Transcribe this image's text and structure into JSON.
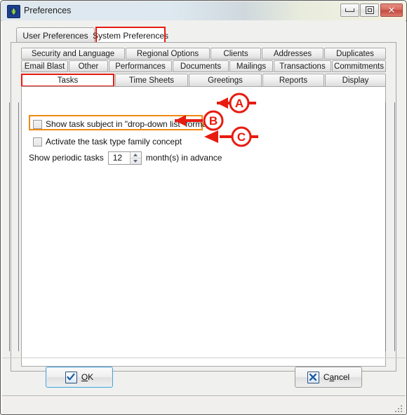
{
  "window": {
    "title": "Preferences",
    "icon": "app-logo-icon",
    "controls": {
      "minimize": "minimize-icon",
      "maximize": "maximize-icon",
      "close": "✕"
    }
  },
  "outer_tabs": {
    "items": [
      {
        "label": "User Preferences",
        "selected": false
      },
      {
        "label": "System Preferences",
        "selected": true,
        "highlight": "red"
      }
    ]
  },
  "inner_tabs": {
    "row1": [
      {
        "label": "Security and Language"
      },
      {
        "label": "Regional Options"
      },
      {
        "label": "Clients"
      },
      {
        "label": "Addresses"
      },
      {
        "label": "Duplicates"
      }
    ],
    "row2": [
      {
        "label": "Email Blast"
      },
      {
        "label": "Other"
      },
      {
        "label": "Performances"
      },
      {
        "label": "Documents"
      },
      {
        "label": "Mailings"
      },
      {
        "label": "Transactions"
      },
      {
        "label": "Commitments"
      }
    ],
    "row3": [
      {
        "label": "Tasks",
        "selected": true,
        "highlight": "red"
      },
      {
        "label": "Time Sheets"
      },
      {
        "label": "Greetings"
      },
      {
        "label": "Reports"
      },
      {
        "label": "Display"
      }
    ]
  },
  "form": {
    "checkbox_show_task_subject": {
      "label": "Show task subject in \"drop-down list\" format",
      "checked": false,
      "highlight": "orange"
    },
    "checkbox_task_type_family": {
      "label": "Activate the task type family concept",
      "checked": false
    },
    "periodic": {
      "prefix": "Show periodic tasks",
      "value": "12",
      "suffix": "month(s) in advance"
    }
  },
  "annotations": [
    {
      "id": "A",
      "label": "A"
    },
    {
      "id": "B",
      "label": "B"
    },
    {
      "id": "C",
      "label": "C"
    }
  ],
  "buttons": {
    "ok": {
      "label": "OK",
      "accel": "O",
      "icon": "check-icon"
    },
    "cancel": {
      "label": "Cancel",
      "accel": "a",
      "icon": "x-icon"
    }
  },
  "colors": {
    "annotation_red": "#e81b10",
    "highlight_orange": "#ef8a13",
    "accent_blue": "#4aa3d8",
    "titlebar_left": "#dfe8ef",
    "titlebar_right": "#f4f2e2"
  }
}
